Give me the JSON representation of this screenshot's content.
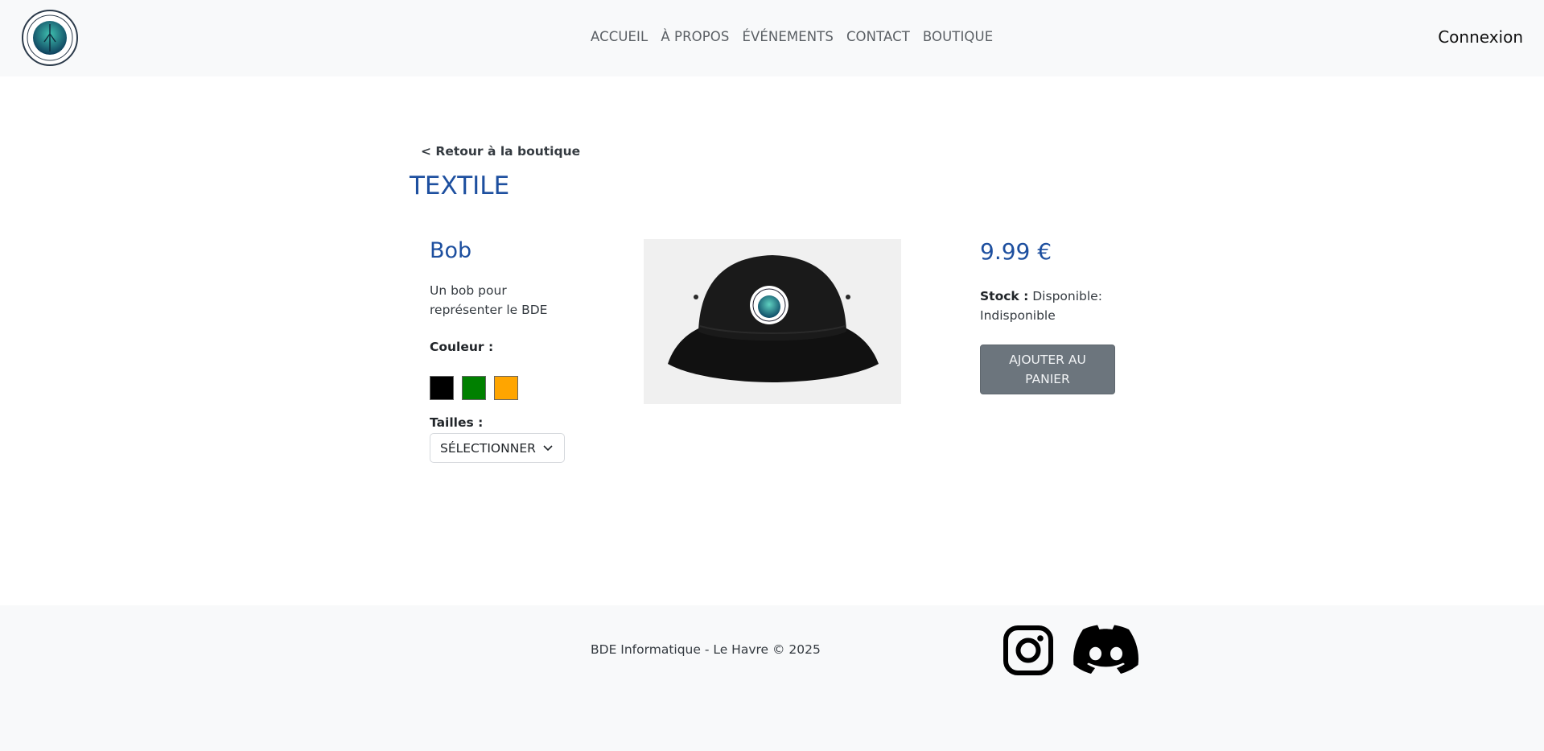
{
  "header": {
    "logo_icon": "bde-logo-icon",
    "nav": [
      "ACCUEIL",
      "À PROPOS",
      "ÉVÉNEMENTS",
      "CONTACT",
      "BOUTIQUE"
    ],
    "login_label": "Connexion"
  },
  "main": {
    "back_link": "< Retour à la boutique",
    "category": "TEXTILE",
    "product": {
      "name": "Bob",
      "description": "Un bob pour représenter le BDE",
      "color_label": "Couleur :",
      "colors": [
        "#000000",
        "#008000",
        "#ffa500"
      ],
      "size_label": "Tailles :",
      "size_select_value": "SÉLECTIONNER",
      "image_icon": "bucket-hat-image",
      "price": "9.99 €",
      "stock_label": "Stock :",
      "stock_value": "Disponible: Indisponible",
      "add_to_cart": "AJOUTER AU PANIER"
    }
  },
  "footer": {
    "copyright": "BDE Informatique - Le Havre © 2025",
    "social_icons": [
      "instagram-icon",
      "discord-icon"
    ]
  },
  "colors": {
    "accent": "#1d4f9f",
    "button": "#6c757d",
    "background_bar": "#f8f9fa"
  }
}
